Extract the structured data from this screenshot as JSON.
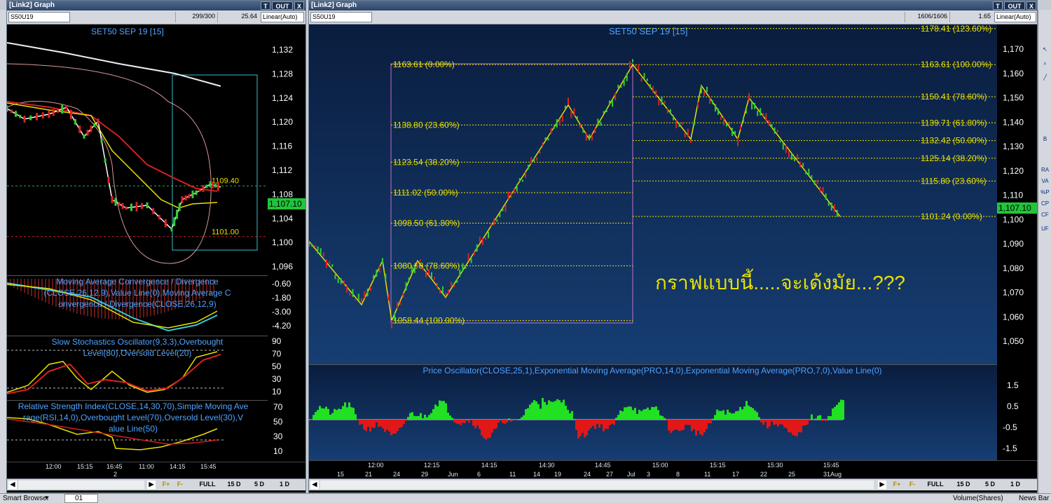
{
  "left_window": {
    "title": "[Link2] Graph",
    "btn_t": "T",
    "btn_out": "OUT",
    "btn_x": "X",
    "symbol": "S50U19",
    "bars": "299/300",
    "last": "25.64",
    "scale": "Linear(Auto)",
    "chart_title": "SET50 SEP 19   [15]",
    "y_ticks": [
      "1,132",
      "1,128",
      "1,124",
      "1,120",
      "1,116",
      "1,112",
      "1,108",
      "1,104",
      "1,100",
      "1,096"
    ],
    "last_price": "1,107.10",
    "level_high": "1109.40",
    "level_low": "1101.00",
    "macd_label": "Moving Average Convergence / Divergence(CLOSE,26,12,9),Value Line(0),Moving Average Convergence / Divergence(CLOSE,26,12,9)",
    "macd_ticks": [
      "-0.60",
      "-1.80",
      "-3.00",
      "-4.20"
    ],
    "stoch_label": "Slow Stochastics Oscillator(9,3,3),Overbought Level(80),Oversold Level(20)",
    "stoch_ticks": [
      "90",
      "70",
      "50",
      "30",
      "10"
    ],
    "rsi_label": "Relative Strength Index(CLOSE,14,30,70),Simple Moving Average(RSI,14,0),Overbought Level(70),Oversold Level(30),Value Line(50)",
    "rsi_ticks": [
      "70",
      "50",
      "30",
      "10"
    ],
    "time_ticks": [
      "12:00",
      "15:15",
      "16:45",
      "11:00",
      "14:15",
      "15:45"
    ],
    "date_ticks": [
      "2"
    ],
    "nav": [
      "FULL",
      "15 D",
      "5 D",
      "1 D"
    ]
  },
  "right_window": {
    "title": "[Link2] Graph",
    "btn_t": "T",
    "btn_out": "OUT",
    "btn_x": "X",
    "symbol": "S50U19",
    "bars": "1606/1606",
    "last": "1.65",
    "scale": "Linear(Auto)",
    "chart_title": "SET50 SEP 19   [15]",
    "y_ticks": [
      "1,170",
      "1,160",
      "1,150",
      "1,140",
      "1,130",
      "1,120",
      "1,110",
      "1,100",
      "1,090",
      "1,080",
      "1,070",
      "1,060",
      "1,050"
    ],
    "last_price": "1,107.10",
    "fib_left": [
      {
        "label": "1163.61 (0.00%)"
      },
      {
        "label": "1138.80 (23.60%)"
      },
      {
        "label": "1123.54 (38.20%)"
      },
      {
        "label": "1111.02 (50.00%)"
      },
      {
        "label": "1098.50 (61.80%)"
      },
      {
        "label": "1080.98 (78.60%)"
      },
      {
        "label": "1058.44 (100.00%)"
      }
    ],
    "fib_right": [
      {
        "label": "1178.41 (123.60%)"
      },
      {
        "label": "1163.61 (100.00%)"
      },
      {
        "label": "1150.41 (78.60%)"
      },
      {
        "label": "1139.71 (61.80%)"
      },
      {
        "label": "1132.42 (50.00%)"
      },
      {
        "label": "1125.14 (38.20%)"
      },
      {
        "label": "1115.80 (23.60%)"
      },
      {
        "label": "1101.24 (0.00%)"
      }
    ],
    "annotation": "กราฟแบบนี้.....จะเด้งมัย...???",
    "osc_label": "Price Oscillator(CLOSE,25,1),Exponential Moving Average(PRO,14,0),Exponential Moving Average(PRO,7,0),Value Line(0)",
    "osc_ticks": [
      "1.5",
      "0.5",
      "-0.5",
      "-1.5"
    ],
    "time_ticks": [
      "12:00",
      "12:15",
      "14:15",
      "14:30",
      "14:45",
      "15:00",
      "15:15",
      "15:30",
      "15:45"
    ],
    "date_ticks": [
      "15",
      "21",
      "24",
      "29",
      "Jun",
      "6",
      "11",
      "14",
      "19",
      "24",
      "27",
      "Jul",
      "3",
      "8",
      "11",
      "17",
      "22",
      "25",
      "31",
      "Aug"
    ],
    "nav": [
      "FULL",
      "15 D",
      "5 D",
      "1 D"
    ]
  },
  "right_toolbar": [
    "B",
    "RA",
    "VA",
    "%P",
    "CP",
    "CF",
    "UF"
  ],
  "status_bar": {
    "smart_browser": "Smart Browser",
    "tab": "01",
    "volume": "Volume(Shares)",
    "news": "News Bar"
  },
  "colors": {
    "bg_left": "#000000",
    "bg_right": "#0c2a52",
    "fib": "#e8e000",
    "up": "#33cc33",
    "down": "#dd2222"
  }
}
